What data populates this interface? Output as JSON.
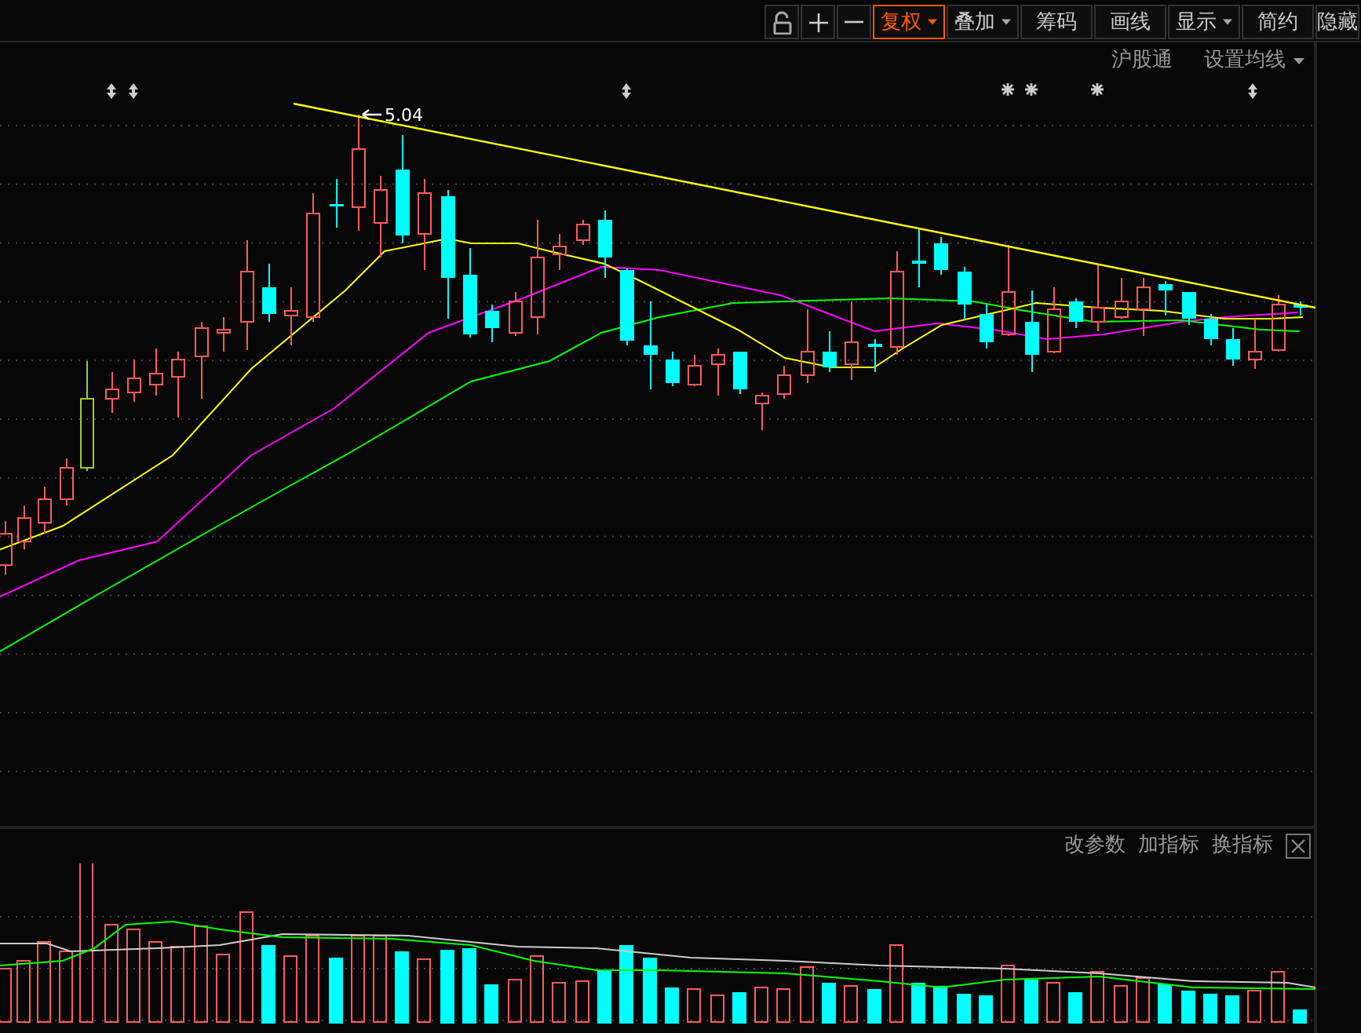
{
  "toolbar": [
    {
      "label": "复权",
      "selected": true,
      "dropdown": true
    },
    {
      "label": "叠加",
      "selected": false,
      "dropdown": true
    },
    {
      "label": "筹码",
      "selected": false,
      "dropdown": false
    },
    {
      "label": "画线",
      "selected": false,
      "dropdown": false
    },
    {
      "label": "显示",
      "selected": false,
      "dropdown": true
    },
    {
      "label": "简约",
      "selected": false,
      "dropdown": false
    },
    {
      "label": "隐藏",
      "selected": false,
      "dropdown": false
    }
  ],
  "chart_links": [
    {
      "label": "沪股通",
      "dropdown": false
    },
    {
      "label": "设置均线",
      "dropdown": true
    }
  ],
  "price_annotation": {
    "label": "5.04"
  },
  "volume_actions": [
    "改参数",
    "加指标",
    "换指标"
  ]
}
